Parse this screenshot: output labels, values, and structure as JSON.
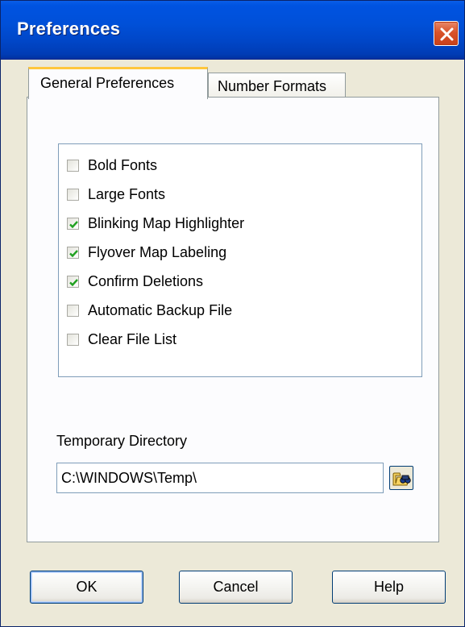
{
  "window": {
    "title": "Preferences"
  },
  "tabs": [
    {
      "label": "General Preferences",
      "selected": true
    },
    {
      "label": "Number Formats",
      "selected": false
    }
  ],
  "options": [
    {
      "label": "Bold Fonts",
      "checked": false
    },
    {
      "label": "Large Fonts",
      "checked": false
    },
    {
      "label": "Blinking Map Highlighter",
      "checked": true
    },
    {
      "label": "Flyover Map Labeling",
      "checked": true
    },
    {
      "label": "Confirm Deletions",
      "checked": true
    },
    {
      "label": "Automatic Backup File",
      "checked": false
    },
    {
      "label": "Clear File List",
      "checked": false
    }
  ],
  "temp_dir": {
    "label": "Temporary Directory",
    "value": "C:\\WINDOWS\\Temp\\"
  },
  "buttons": {
    "ok": "OK",
    "cancel": "Cancel",
    "help": "Help"
  },
  "icons": {
    "close": "close-icon",
    "browse": "browse-folder-icon",
    "check": "checkmark-icon"
  },
  "colors": {
    "titlebar": "#0053e1",
    "dialog_bg": "#ece9d8",
    "close_button": "#d9532a",
    "check_green": "#21a121",
    "tab_highlight": "#ffc73c"
  }
}
